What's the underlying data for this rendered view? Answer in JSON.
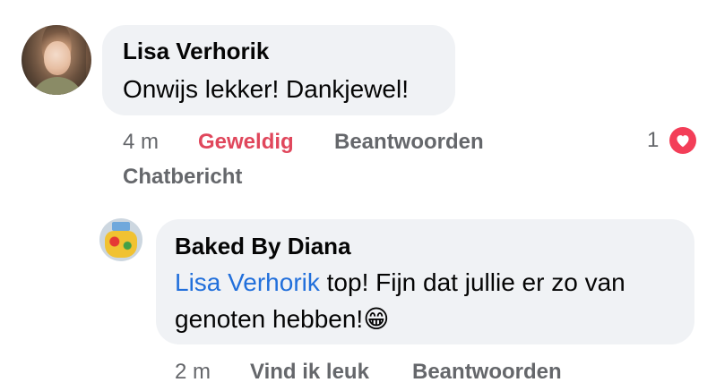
{
  "comments": [
    {
      "author": "Lisa Verhorik",
      "text": "Onwijs lekker! Dankjewel!",
      "time": "4 m",
      "reaction_label": "Geweldig",
      "reply_label": "Beantwoorden",
      "chat_label": "Chatbericht",
      "reaction_count": "1",
      "reaction_icon": "heart-icon"
    },
    {
      "author": "Baked By Diana",
      "mention": "Lisa Verhorik",
      "text_line1_rest": " top! Fijn dat jullie er zo van",
      "text_line2": "genoten hebben!",
      "emoji": "😁",
      "time": "2 m",
      "like_label": "Vind ik leuk",
      "reply_label": "Beantwoorden"
    }
  ],
  "colors": {
    "bubble": "#f0f2f5",
    "meta": "#65676b",
    "reaction": "#e0475c",
    "mention": "#216fdb",
    "heart": "#f33e58"
  }
}
